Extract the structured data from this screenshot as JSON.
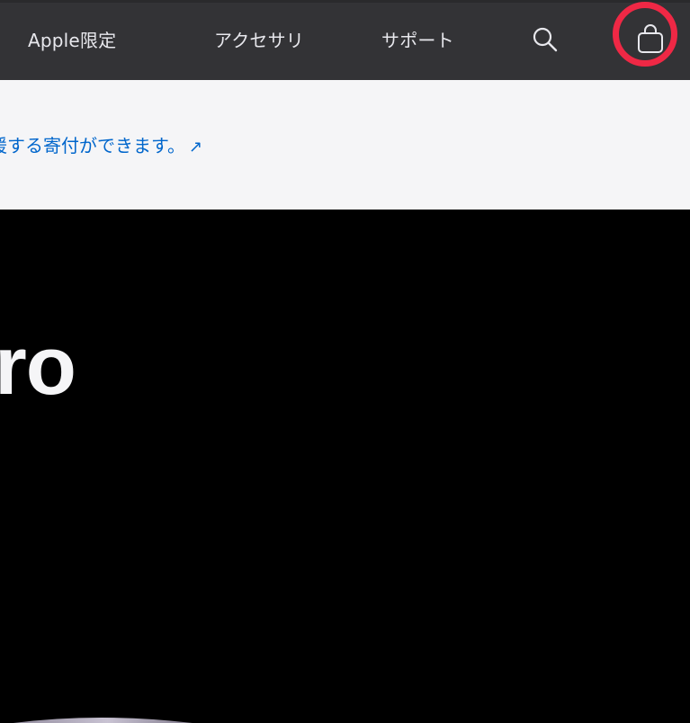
{
  "nav": {
    "items": [
      {
        "label": "Apple限定"
      },
      {
        "label": "アクセサリ"
      },
      {
        "label": "サポート"
      }
    ],
    "search_icon": "search-icon",
    "bag_icon": "bag-icon",
    "highlight_color": "#ef2845",
    "background": "#333336"
  },
  "ribbon": {
    "text": "援する寄付ができます。",
    "arrow": "↗",
    "link_color": "#0066cc"
  },
  "hero": {
    "title": "ro"
  }
}
